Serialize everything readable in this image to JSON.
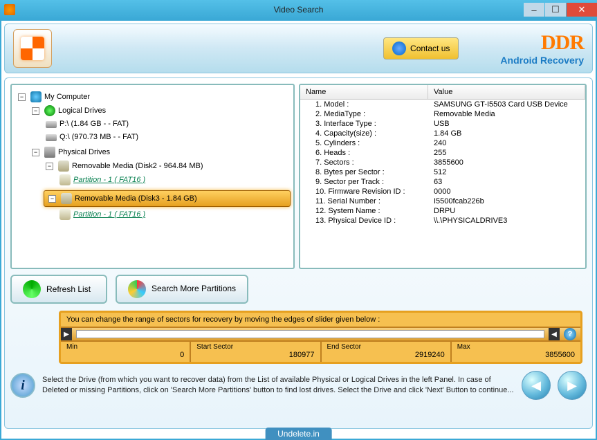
{
  "window": {
    "title": "Video Search"
  },
  "header": {
    "contact": "Contact us",
    "brand": "DDR",
    "sub": "Android Recovery"
  },
  "tree": {
    "root": "My Computer",
    "logical": {
      "label": "Logical Drives",
      "drives": [
        "P:\\ (1.84 GB -  - FAT)",
        "Q:\\ (970.73 MB -  - FAT)"
      ]
    },
    "physical": {
      "label": "Physical Drives",
      "media1": {
        "label": "Removable Media (Disk2 - 964.84 MB)",
        "part": "Partition - 1 ( FAT16 )"
      },
      "media2": {
        "label": "Removable Media (Disk3 - 1.84 GB)",
        "part": "Partition - 1 ( FAT16 )"
      }
    }
  },
  "props": {
    "col1": "Name",
    "col2": "Value",
    "rows": [
      {
        "n": "1. Model :",
        "v": "SAMSUNG GT-I5503 Card USB Device"
      },
      {
        "n": "2. MediaType :",
        "v": "Removable Media"
      },
      {
        "n": "3. Interface Type :",
        "v": "USB"
      },
      {
        "n": "4. Capacity(size) :",
        "v": "1.84 GB"
      },
      {
        "n": "5. Cylinders :",
        "v": "240"
      },
      {
        "n": "6. Heads :",
        "v": "255"
      },
      {
        "n": "7. Sectors :",
        "v": "3855600"
      },
      {
        "n": "8. Bytes per Sector :",
        "v": "512"
      },
      {
        "n": "9. Sector per Track :",
        "v": "63"
      },
      {
        "n": "10. Firmware Revision ID :",
        "v": "0000"
      },
      {
        "n": "11. Serial Number :",
        "v": "I5500fcab226b"
      },
      {
        "n": "12. System Name :",
        "v": "DRPU"
      },
      {
        "n": "13. Physical Device ID :",
        "v": "\\\\.\\PHYSICALDRIVE3"
      }
    ]
  },
  "buttons": {
    "refresh": "Refresh List",
    "search": "Search More Partitions"
  },
  "slider": {
    "msg": "You can change the range of sectors for recovery by moving the edges of slider given below :",
    "min_lbl": "Min",
    "min": "0",
    "start_lbl": "Start Sector",
    "start": "180977",
    "end_lbl": "End Sector",
    "end": "2919240",
    "max_lbl": "Max",
    "max": "3855600"
  },
  "footer": {
    "text": "Select the Drive (from which you want to recover data) from the List of available Physical or Logical Drives in the left Panel. In case of Deleted or missing Partitions, click on 'Search More Partitions' button to find lost drives. Select the Drive and click 'Next' Button to continue..."
  },
  "watermark": "Undelete.in"
}
